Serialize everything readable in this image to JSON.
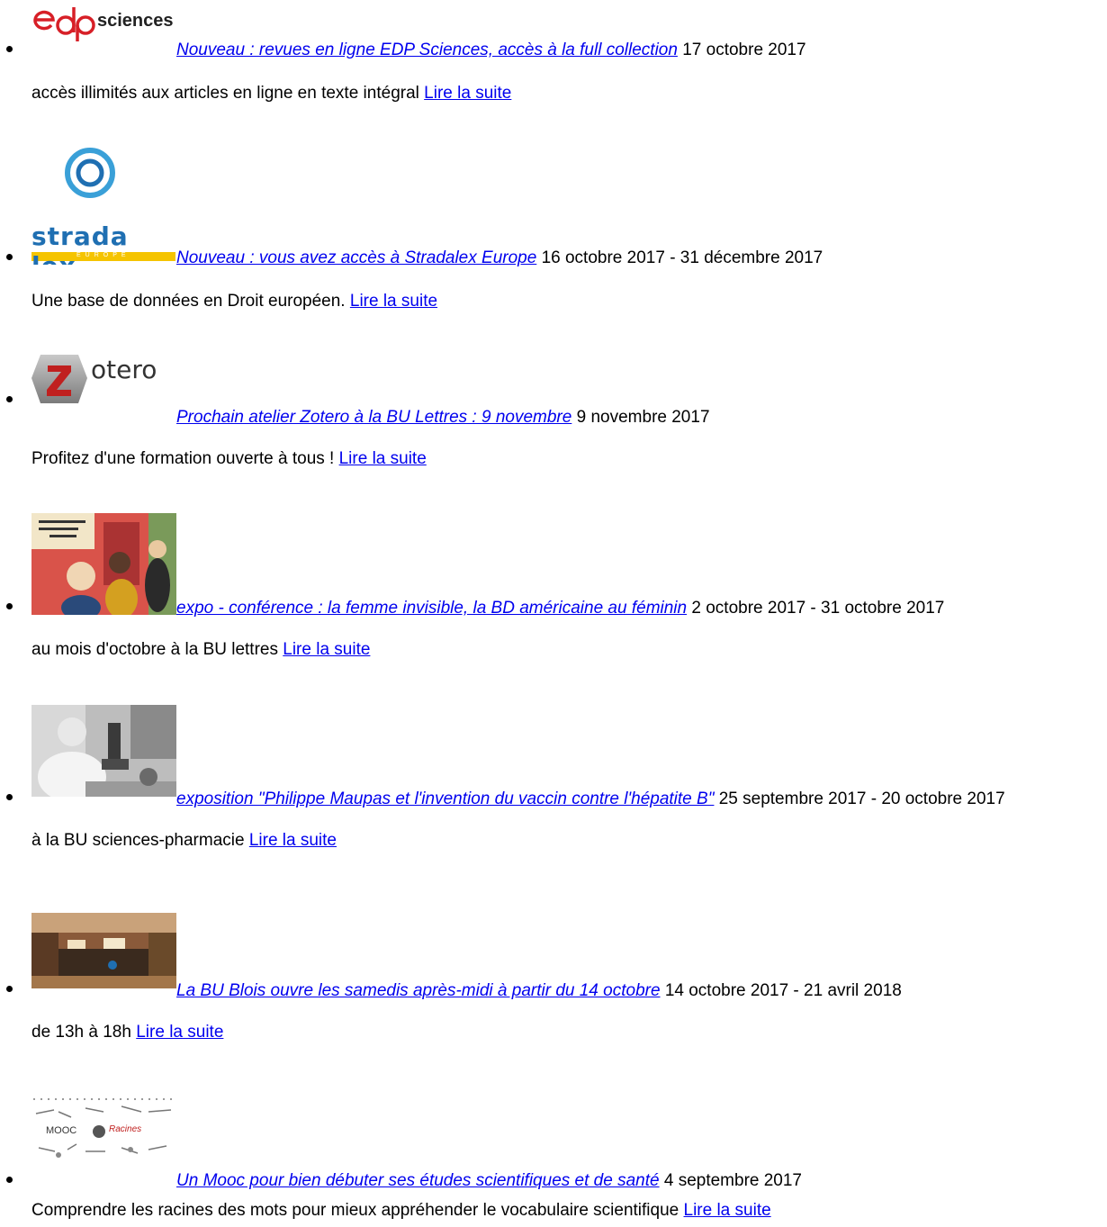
{
  "items": [
    {
      "logo_text": "sciences",
      "title": "Nouveau : revues en ligne EDP Sciences, accès à la full collection",
      "date": "17 octobre 2017",
      "summary": "accès illimités aux articles en ligne en texte intégral",
      "more": "Lire la suite"
    },
    {
      "logo_text": "strada lex",
      "logo_sub": "EUROPE",
      "title": "Nouveau : vous avez accès à Stradalex Europe",
      "date": "16 octobre 2017 - 31 décembre 2017",
      "summary": "Une base de données en Droit européen.",
      "more": "Lire la suite"
    },
    {
      "logo_text": "otero",
      "title": "Prochain atelier Zotero à la BU Lettres : 9 novembre",
      "date": "9 novembre 2017",
      "summary": "Profitez d'une formation ouverte à tous !",
      "more": "Lire la suite"
    },
    {
      "title": "expo - conférence : la femme invisible, la BD américaine au féminin",
      "date": "2 octobre 2017 - 31 octobre 2017",
      "summary": "au mois d'octobre à la BU lettres",
      "more": "Lire la suite"
    },
    {
      "title": "exposition \"Philippe Maupas et l'invention du vaccin contre l'hépatite B\"",
      "date": "25 septembre 2017 - 20 octobre 2017",
      "summary": "à la BU sciences-pharmacie",
      "more": "Lire la suite"
    },
    {
      "title": "La BU Blois ouvre les samedis après-midi à partir du 14 octobre",
      "date": "14 octobre 2017 - 21 avril 2018",
      "summary": "de 13h à 18h",
      "more": "Lire la suite"
    },
    {
      "logo_text": "MOOC",
      "logo_text_2": "Racines",
      "title": "Un Mooc pour bien débuter ses études scientifiques et de santé",
      "date": "4 septembre 2017",
      "summary": "Comprendre les racines des mots pour mieux appréhender le vocabulaire scientifique",
      "more": "Lire la suite"
    }
  ],
  "colors": {
    "link": "#0000ee",
    "edp_red": "#d71f27",
    "strada_blue": "#1f6fb2",
    "strada_yellow": "#f5c400"
  }
}
